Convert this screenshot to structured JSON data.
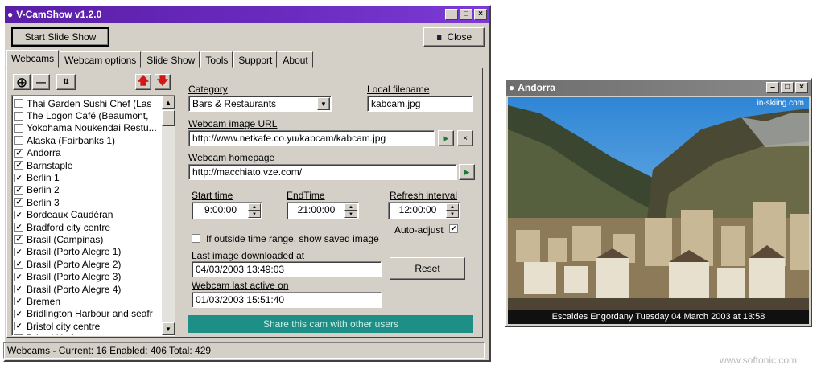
{
  "main_window": {
    "title": "V-CamShow v1.2.0",
    "start_button": "Start Slide Show",
    "close_button": "Close",
    "tabs": [
      "Webcams",
      "Webcam options",
      "Slide Show",
      "Tools",
      "Support",
      "About"
    ],
    "active_tab": "Webcams"
  },
  "toolbar": {
    "add_icon": "plus-icon",
    "remove_icon": "minus-icon",
    "refresh_icon": "swap-icon",
    "move_up_icon": "red-arrow-up-icon",
    "move_down_icon": "red-arrow-down-icon"
  },
  "webcam_list": [
    {
      "name": "Thai Garden Sushi Chef (Las",
      "checked": false
    },
    {
      "name": "The Logon Café (Beaumont,",
      "checked": false
    },
    {
      "name": "Yokohama Noukendai Restu...",
      "checked": false
    },
    {
      "name": "Alaska (Fairbanks 1)",
      "checked": false
    },
    {
      "name": "Andorra",
      "checked": true
    },
    {
      "name": "Barnstaple",
      "checked": true
    },
    {
      "name": "Berlin 1",
      "checked": true
    },
    {
      "name": "Berlin 2",
      "checked": true
    },
    {
      "name": "Berlin 3",
      "checked": true
    },
    {
      "name": "Bordeaux Caudéran",
      "checked": true
    },
    {
      "name": "Bradford city centre",
      "checked": true
    },
    {
      "name": "Brasil (Campinas)",
      "checked": true
    },
    {
      "name": "Brasil (Porto Alegre 1)",
      "checked": true
    },
    {
      "name": "Brasil (Porto Alegre 2)",
      "checked": true
    },
    {
      "name": "Brasil (Porto Alegre 3)",
      "checked": true
    },
    {
      "name": "Brasil (Porto Alegre 4)",
      "checked": true
    },
    {
      "name": "Bremen",
      "checked": true
    },
    {
      "name": "Bridlington Harbour and seafr",
      "checked": true
    },
    {
      "name": "Bristol city centre",
      "checked": true
    },
    {
      "name": "Bristol Harbour",
      "checked": true
    }
  ],
  "details": {
    "category_label": "Category",
    "category_value": "Bars & Restaurants",
    "local_filename_label": "Local filename",
    "local_filename_value": "kabcam.jpg",
    "image_url_label": "Webcam image URL",
    "image_url_value": "http://www.netkafe.co.yu/kabcam/kabcam.jpg",
    "homepage_label": "Webcam homepage",
    "homepage_value": "http://macchiato.vze.com/",
    "start_time_label": "Start time",
    "start_time_value": "9:00:00",
    "end_time_label": "EndTime",
    "end_time_value": "21:00:00",
    "refresh_label": "Refresh interval",
    "refresh_value": "12:00:00",
    "auto_adjust_label": "Auto-adjust",
    "auto_adjust_checked": true,
    "outside_range_label": "If outside time range, show saved image",
    "outside_range_checked": false,
    "last_download_label": "Last image downloaded at",
    "last_download_value": "04/03/2003 13:49:03",
    "reset_button": "Reset",
    "last_active_label": "Webcam last active on",
    "last_active_value": "01/03/2003 15:51:40",
    "share_button": "Share this cam with other users"
  },
  "status_bar": "Webcams - Current: 16  Enabled: 406  Total: 429",
  "cam_window": {
    "title": "Andorra",
    "overlay_site": "in-skiing.com",
    "caption": "Escaldes Engordany    Tuesday 04 March 2003 at 13:58"
  },
  "watermark": "www.softonic.com",
  "colors": {
    "title_active": "#5a1ea6",
    "title_inactive": "#7a7a7a",
    "share_bg": "#1e8f86",
    "arrow_red": "#d01818"
  }
}
